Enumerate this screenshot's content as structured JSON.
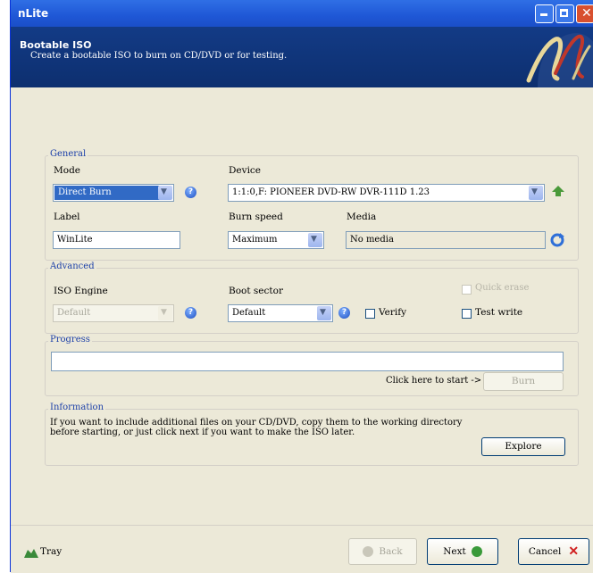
{
  "window": {
    "title": "nLite"
  },
  "header": {
    "title": "Bootable ISO",
    "subtitle": "Create a bootable ISO to burn on CD/DVD or for testing."
  },
  "general": {
    "legend": "General",
    "mode_label": "Mode",
    "mode_value": "Direct Burn",
    "device_label": "Device",
    "device_value": "1:1:0,F: PIONEER  DVD-RW  DVR-111D 1.23",
    "label_label": "Label",
    "label_value": "WinLite",
    "burn_speed_label": "Burn speed",
    "burn_speed_value": "Maximum",
    "media_label": "Media",
    "media_value": "No media"
  },
  "advanced": {
    "legend": "Advanced",
    "iso_engine_label": "ISO Engine",
    "iso_engine_value": "Default",
    "boot_sector_label": "Boot sector",
    "boot_sector_value": "Default",
    "quick_erase_label": "Quick erase",
    "verify_label": "Verify",
    "test_write_label": "Test write"
  },
  "progress": {
    "legend": "Progress",
    "hint": "Click here to start ->",
    "burn_label": "Burn"
  },
  "information": {
    "legend": "Information",
    "text_line1": "If you want to include additional files on your CD/DVD, copy them to the working directory",
    "text_line2": "before starting, or just click next if you want to make the ISO later.",
    "explore_label": "Explore"
  },
  "footer": {
    "tray_label": "Tray",
    "back_label": "Back",
    "next_label": "Next",
    "cancel_label": "Cancel"
  },
  "colors": {
    "header_bg": "#0d2f6f",
    "titlebar": "#1f57d6",
    "legend_text": "#1b3fa8",
    "selection": "#316ac5"
  },
  "icons": [
    "help-icon",
    "refresh-icon",
    "eject-icon",
    "tray-icon",
    "back-icon",
    "next-icon",
    "cancel-icon",
    "nlite-logo"
  ]
}
